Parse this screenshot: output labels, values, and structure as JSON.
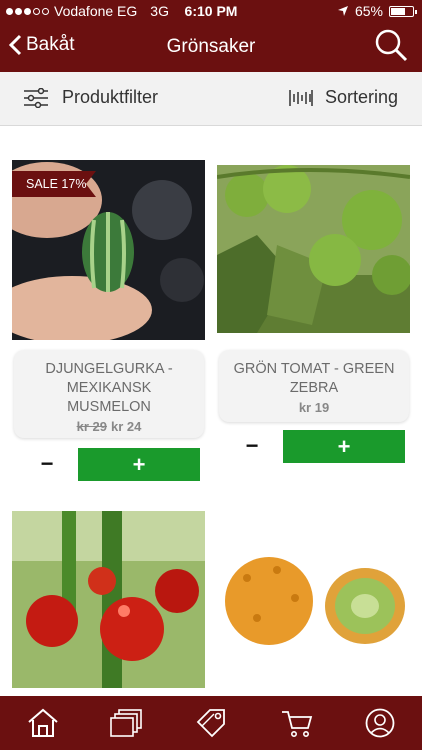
{
  "status": {
    "carrier": "Vodafone EG",
    "network": "3G",
    "time": "6:10 PM",
    "battery": "65%",
    "battery_level": 0.65
  },
  "nav": {
    "back_label": "Bakåt",
    "title": "Grönsaker"
  },
  "filterbar": {
    "filter_label": "Produktfilter",
    "sort_label": "Sortering"
  },
  "products": [
    {
      "badge": "SALE 17%",
      "name": "DJUNGELGURKA - MEXIKANSK MUSMELON",
      "old_price": "kr 29",
      "price": "kr 24",
      "minus": "−",
      "plus": "+"
    },
    {
      "name": "GRÖN TOMAT - GREEN ZEBRA",
      "price": "kr 19",
      "minus": "−",
      "plus": "+"
    }
  ],
  "tabs": [
    "home-icon",
    "gallery-icon",
    "tags-icon",
    "cart-icon",
    "profile-icon"
  ],
  "colors": {
    "brand": "#6b1010",
    "add_button": "#1a9a2c",
    "filter_bg": "#f2f2f2"
  }
}
